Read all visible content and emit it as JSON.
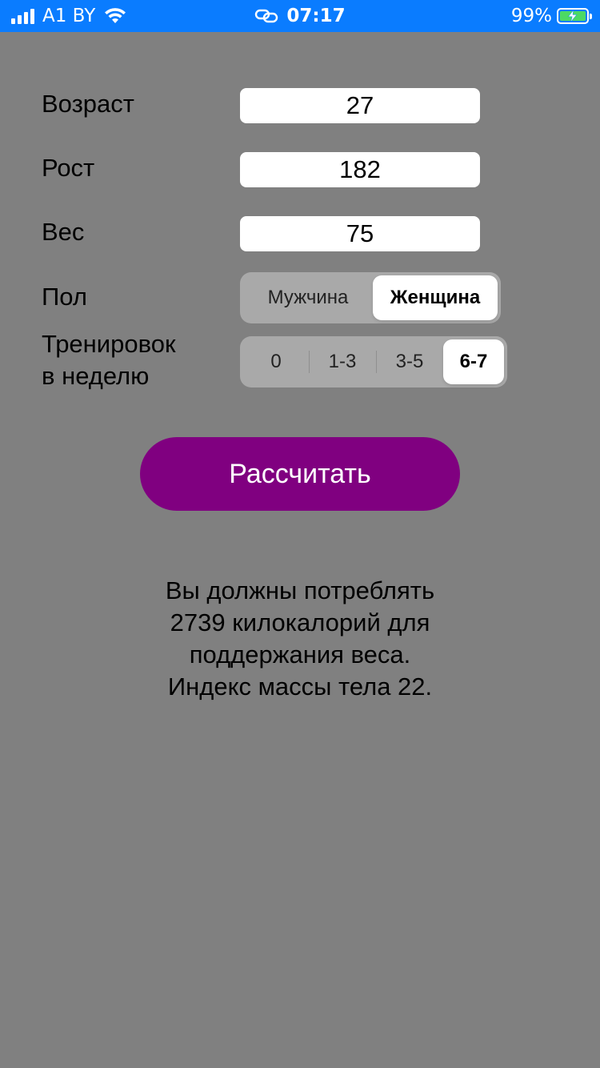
{
  "status_bar": {
    "carrier": "A1 BY",
    "time": "07:17",
    "battery_percent": "99%",
    "battery_level": 0.99,
    "icons": [
      "signal-icon",
      "wifi-icon",
      "link-icon",
      "battery-charging-icon"
    ]
  },
  "form": {
    "age": {
      "label": "Возраст",
      "value": "27"
    },
    "height": {
      "label": "Рост",
      "value": "182"
    },
    "weight": {
      "label": "Вес",
      "value": "75"
    },
    "sex": {
      "label": "Пол",
      "options": [
        "Мужчина",
        "Женщина"
      ],
      "selected": "Женщина"
    },
    "training": {
      "label_line1": "Тренировок",
      "label_line2": "в неделю",
      "options": [
        "0",
        "1-3",
        "3-5",
        "6-7"
      ],
      "selected": "6-7"
    }
  },
  "actions": {
    "calculate_label": "Рассчитать"
  },
  "result": {
    "line1": "Вы должны потреблять",
    "line2": "2739 килокалорий для",
    "line3": "поддержания веса.",
    "line4": "Индекс массы тела 22."
  },
  "colors": {
    "background": "#808080",
    "status_bar": "#0a7cff",
    "button": "#800080",
    "battery_fill": "#4cd964"
  }
}
